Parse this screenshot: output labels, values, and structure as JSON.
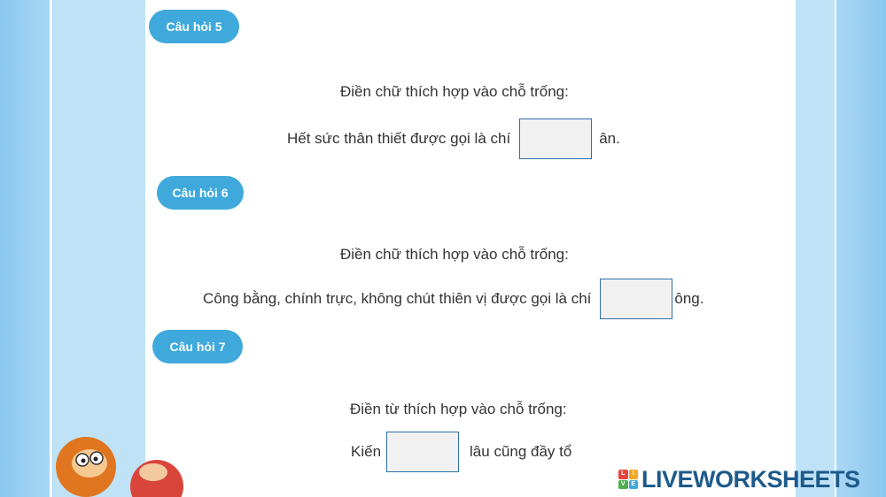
{
  "questions": [
    {
      "badge": "Câu hỏi 5",
      "instruction": "Điền chữ thích hợp vào chỗ trống:",
      "before": "Hết sức thân thiết được gọi là chí",
      "after": "ân."
    },
    {
      "badge": "Câu hỏi 6",
      "instruction": "Điền chữ thích hợp vào chỗ trống:",
      "before": "Công bằng, chính trực, không chút thiên vị được gọi là chí",
      "after": "ông."
    },
    {
      "badge": "Câu hỏi 7",
      "instruction": "Điền từ thích hợp vào chỗ trống:",
      "before": "Kiến",
      "after": "lâu cũng đầy tổ"
    }
  ],
  "brand": {
    "name": "LIVEWORKSHEETS",
    "icon_letters": [
      "L",
      "I",
      "V",
      "E"
    ],
    "icon_colors": [
      "#e8433c",
      "#f5a623",
      "#4caf50",
      "#3fa9dc"
    ]
  },
  "colors": {
    "badge": "#3fa9dc",
    "blank_border": "#2f6fa8",
    "text": "#333333",
    "background_side": "#a9d7f4"
  }
}
